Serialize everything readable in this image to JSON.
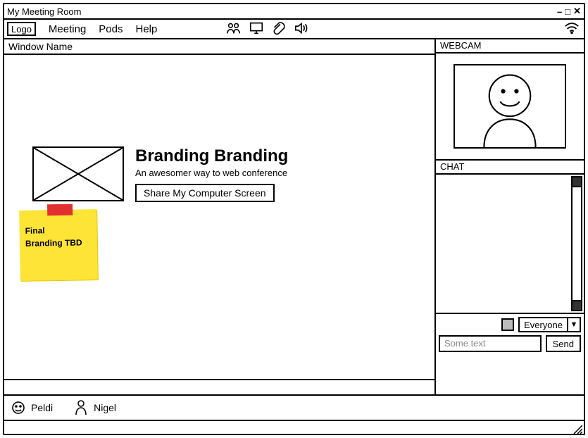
{
  "window": {
    "title": "My Meeting Room",
    "logo": "Logo"
  },
  "menu": {
    "items": [
      "Meeting",
      "Pods",
      "Help"
    ]
  },
  "main_pane": {
    "title": "Window Name",
    "headline": "Branding Branding",
    "subhead": "An awesomer way to web conference",
    "share_button": "Share My Computer Screen",
    "sticky_line1": "Final",
    "sticky_line2": "Branding TBD"
  },
  "webcam": {
    "title": "WEBCAM"
  },
  "chat": {
    "title": "CHAT",
    "recipient": "Everyone",
    "input_placeholder": "Some text",
    "send": "Send"
  },
  "participants": [
    {
      "name": "Peldi"
    },
    {
      "name": "Nigel"
    }
  ]
}
